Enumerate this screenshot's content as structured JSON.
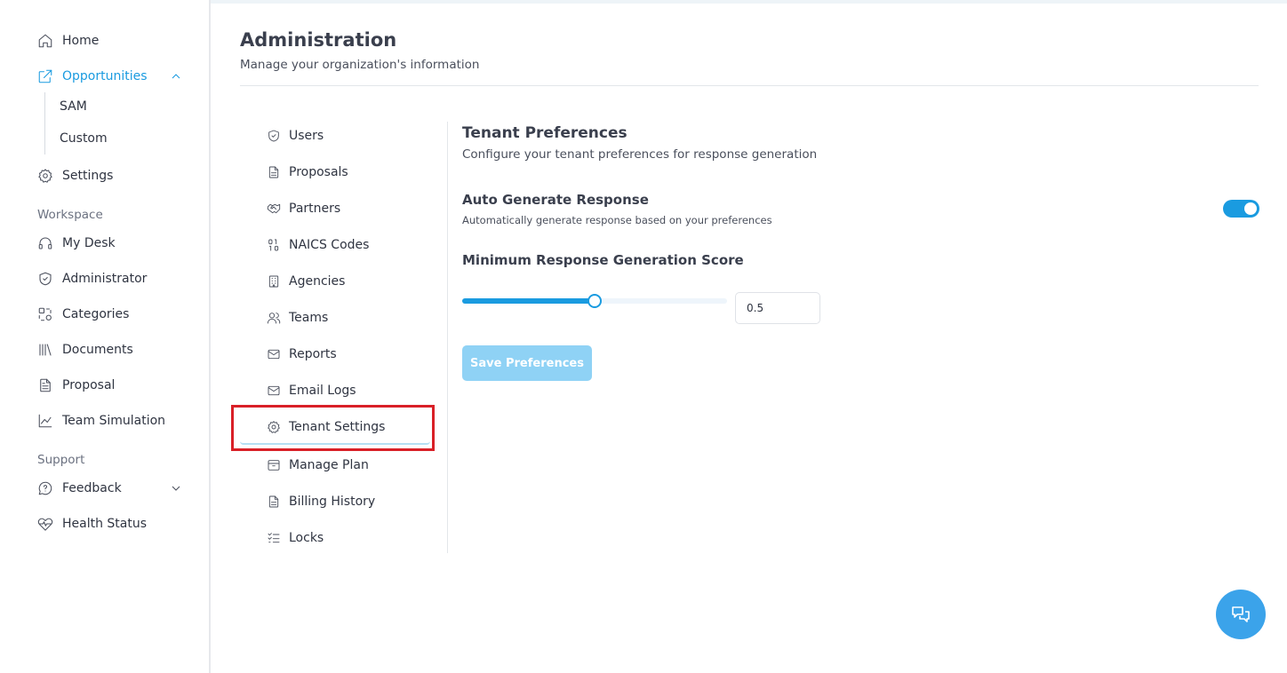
{
  "sidebar": {
    "items": [
      {
        "label": "Home",
        "icon": "home-icon"
      },
      {
        "label": "Opportunities",
        "icon": "external-link-icon",
        "active": true
      },
      {
        "label": "Settings",
        "icon": "gear-icon"
      }
    ],
    "sub_items": [
      "SAM",
      "Custom"
    ],
    "workspace_label": "Workspace",
    "workspace_items": [
      {
        "label": "My Desk",
        "icon": "headset-icon"
      },
      {
        "label": "Administrator",
        "icon": "shield-check-icon"
      },
      {
        "label": "Categories",
        "icon": "categories-icon"
      },
      {
        "label": "Documents",
        "icon": "library-icon"
      },
      {
        "label": "Proposal",
        "icon": "file-text-icon"
      },
      {
        "label": "Team Simulation",
        "icon": "line-chart-icon"
      }
    ],
    "support_label": "Support",
    "support_items": [
      {
        "label": "Feedback",
        "icon": "message-question-icon"
      },
      {
        "label": "Health Status",
        "icon": "heart-pulse-icon"
      }
    ]
  },
  "header": {
    "title": "Administration",
    "subtitle": "Manage your organization's information"
  },
  "admin_nav": {
    "items": [
      {
        "label": "Users",
        "icon": "shield-check-icon"
      },
      {
        "label": "Proposals",
        "icon": "file-text-icon"
      },
      {
        "label": "Partners",
        "icon": "handshake-icon"
      },
      {
        "label": "NAICS Codes",
        "icon": "binary-icon"
      },
      {
        "label": "Agencies",
        "icon": "building-icon"
      },
      {
        "label": "Teams",
        "icon": "users-icon"
      },
      {
        "label": "Reports",
        "icon": "mail-icon"
      },
      {
        "label": "Email Logs",
        "icon": "mail-icon"
      },
      {
        "label": "Tenant Settings",
        "icon": "gear-icon",
        "active": true
      },
      {
        "label": "Manage Plan",
        "icon": "archive-icon"
      },
      {
        "label": "Billing History",
        "icon": "file-text-icon"
      },
      {
        "label": "Locks",
        "icon": "list-checks-icon"
      }
    ]
  },
  "tenant": {
    "title": "Tenant Preferences",
    "subtitle": "Configure your tenant preferences for response generation",
    "auto_generate": {
      "title": "Auto Generate Response",
      "description": "Automatically generate response based on your preferences",
      "enabled": true
    },
    "min_score": {
      "title": "Minimum Response Generation Score",
      "value": 0.5,
      "value_text": "0.5"
    },
    "save_label": "Save Preferences"
  },
  "colors": {
    "accent": "#1a9be0",
    "save_button_disabled": "#8fd2f5",
    "highlight_box": "#d92027",
    "chat_fab": "#3ba3ea"
  },
  "chat_fab": {
    "icon": "chat-bubbles-icon"
  }
}
